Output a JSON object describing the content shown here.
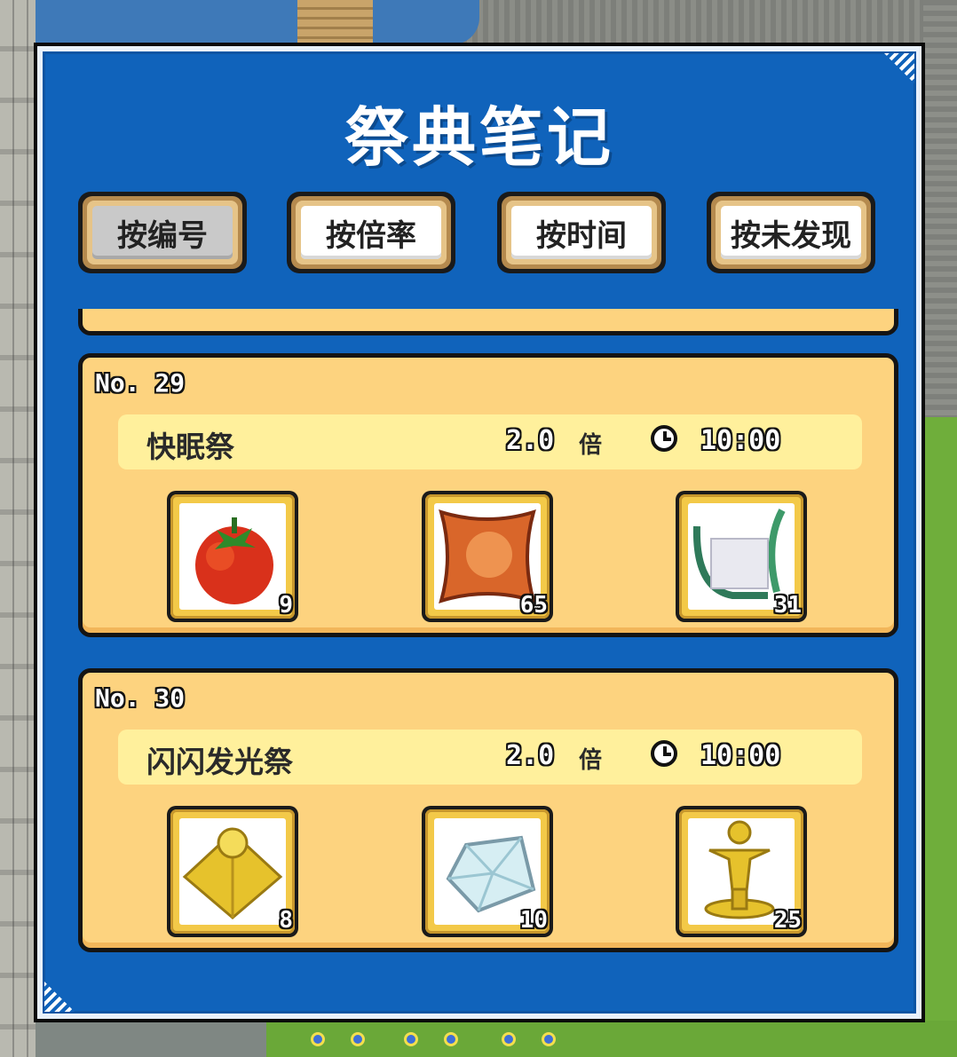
{
  "panel": {
    "title": "祭典笔记"
  },
  "sort_buttons": [
    {
      "label": "按编号",
      "active": true
    },
    {
      "label": "按倍率",
      "active": false
    },
    {
      "label": "按时间",
      "active": false
    },
    {
      "label": "按未发现",
      "active": false
    }
  ],
  "festivals": [
    {
      "number": "No. 29",
      "name": "快眠祭",
      "rate": "2.0",
      "rate_unit": "倍",
      "time": "10:00",
      "items": [
        {
          "icon": "tomato-icon",
          "count": "9"
        },
        {
          "icon": "cushion-icon",
          "count": "65"
        },
        {
          "icon": "harp-icon",
          "count": "31"
        }
      ]
    },
    {
      "number": "No. 30",
      "name": "闪闪发光祭",
      "rate": "2.0",
      "rate_unit": "倍",
      "time": "10:00",
      "items": [
        {
          "icon": "gold-pyramid-icon",
          "count": "8"
        },
        {
          "icon": "diamond-icon",
          "count": "10"
        },
        {
          "icon": "gold-statue-icon",
          "count": "25"
        }
      ]
    }
  ]
}
